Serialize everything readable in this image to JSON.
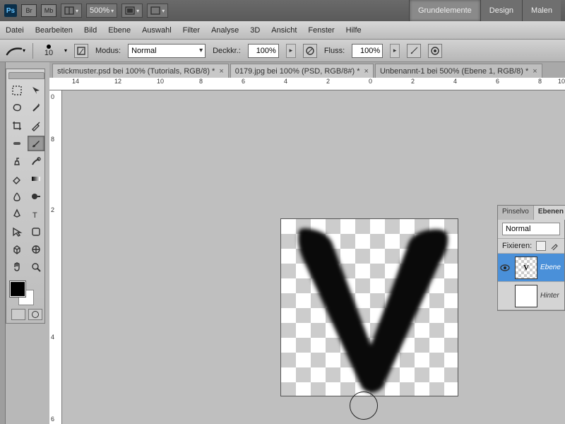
{
  "appbar": {
    "bridge": "Br",
    "mb": "Mb",
    "zoom": "500%",
    "modes": [
      "Grundelemente",
      "Design",
      "Malen"
    ],
    "activeMode": 0
  },
  "menu": [
    "Datei",
    "Bearbeiten",
    "Bild",
    "Ebene",
    "Auswahl",
    "Filter",
    "Analyse",
    "3D",
    "Ansicht",
    "Fenster",
    "Hilfe"
  ],
  "optbar": {
    "brushSize": "10",
    "modusLabel": "Modus:",
    "modusValue": "Normal",
    "deckLabel": "Deckkr.:",
    "deckValue": "100%",
    "flussLabel": "Fluss:",
    "flussValue": "100%"
  },
  "tabs": [
    {
      "label": "stickmuster.psd bei 100% (Tutorials, RGB/8) *"
    },
    {
      "label": "0179.jpg bei 100% (PSD, RGB/8#) *"
    },
    {
      "label": "Unbenannt-1 bei 500% (Ebene 1, RGB/8) *"
    }
  ],
  "activeTab": 2,
  "rulerH": [
    "14",
    "12",
    "10",
    "8",
    "6",
    "4",
    "2",
    "0",
    "2",
    "4",
    "6",
    "8",
    "10"
  ],
  "rulerV": [
    "0",
    "8",
    "2",
    "4",
    "6"
  ],
  "layers": {
    "panelTabs": [
      "Pinselvo",
      "Ebenen"
    ],
    "activePanelTab": 1,
    "blendMode": "Normal",
    "fixLabel": "Fixieren:",
    "items": [
      {
        "name": "Ebene",
        "thumbGlyph": "V",
        "visible": true,
        "active": true
      },
      {
        "name": "Hinter",
        "thumbGlyph": "",
        "visible": false,
        "active": false
      }
    ]
  }
}
